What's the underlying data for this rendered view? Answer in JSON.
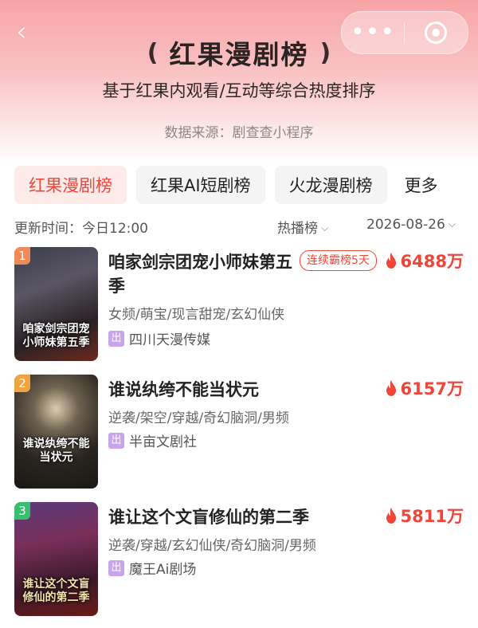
{
  "nav": {
    "back_icon": "chevron-left-icon",
    "more_icon": "more-dots-icon",
    "close_icon": "target-icon"
  },
  "header": {
    "title": "红果漫剧榜",
    "subtitle": "基于红果内观看/互动等综合热度排序",
    "source": "数据来源：剧查查小程序"
  },
  "tabs": [
    {
      "label": "红果漫剧榜",
      "active": true
    },
    {
      "label": "红果AI短剧榜",
      "active": false
    },
    {
      "label": "火龙漫剧榜",
      "active": false
    }
  ],
  "tabs_more": "更多",
  "meta": {
    "update": "更新时间：今日12:00",
    "sort": "热播榜",
    "date": "2026-08-26"
  },
  "colors": {
    "accent": "#f0463a",
    "rank1": "#f28a57",
    "rank2": "#f2a23e",
    "rank3": "#34c06d",
    "producer_badge": "#c8a5ea"
  },
  "items": [
    {
      "rank": "1",
      "name": "咱家剑宗团宠小师妹第五季",
      "streak": "连续霸榜5天",
      "heat": "6488万",
      "tags": "女频/萌宝/现言甜宠/玄幻仙侠",
      "producer_badge": "出",
      "producer": "四川天漫传媒",
      "cover_text": "咱家剑宗团宠小师妹第五季"
    },
    {
      "rank": "2",
      "name": "谁说纨绔不能当状元",
      "heat": "6157万",
      "tags": "逆袭/架空/穿越/奇幻脑洞/男频",
      "producer_badge": "出",
      "producer": "半亩文剧社",
      "cover_text": "谁说纨绔不能当状元"
    },
    {
      "rank": "3",
      "name": "谁让这个文盲修仙的第二季",
      "heat": "5811万",
      "tags": "逆袭/穿越/玄幻仙侠/奇幻脑洞/男频",
      "producer_badge": "出",
      "producer": "魔王Ai剧场",
      "cover_text": "谁让这个文盲修仙的第二季"
    }
  ]
}
